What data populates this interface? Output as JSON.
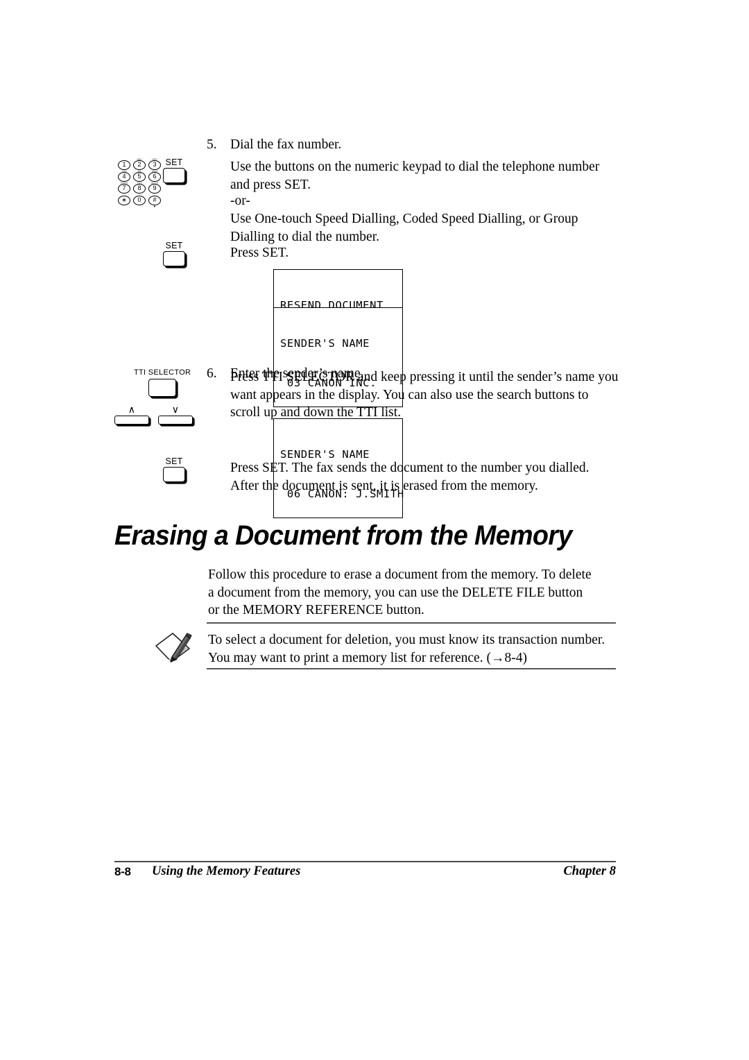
{
  "page": {
    "background": "#ffffff"
  },
  "steps": [
    {
      "number": "5.",
      "title": "Dial the fax number.",
      "paragraphs": [
        "Use the buttons on the numeric keypad to dial the telephone number and press SET.",
        "-or-",
        "Use One-touch Speed Dialling, Coded Speed Dialling, or Group Dialling to dial the number.",
        "Press SET."
      ]
    },
    {
      "number": "6.",
      "title": "Enter the sender’s name.",
      "paragraphs": [
        "Press TTI SELECTOR and keep pressing it until the sender’s name you want appears in the display. You can also use the search buttons to scroll up and down the TTI list.",
        "Press SET. The fax sends the document to the number you dialled. After the document is sent, it is erased from the memory."
      ]
    }
  ],
  "displays": [
    {
      "line1": "RESEND DOCUMENT",
      "line2": "SENDER'S NAME"
    },
    {
      "line1": "SENDER'S NAME",
      "line2": " 03 CANON INC."
    },
    {
      "line1": "SENDER'S NAME",
      "line2": " 06 CANON: J.SMITH"
    }
  ],
  "buttons": {
    "set": "SET",
    "tti_selector": "TTI SELECTOR",
    "search_up": "∧",
    "search_down": "∨"
  },
  "keypad": {
    "keys": [
      {
        "digit": "1",
        "sub": ""
      },
      {
        "digit": "2",
        "sub": "ABC"
      },
      {
        "digit": "3",
        "sub": "DEF"
      },
      {
        "digit": "4",
        "sub": "GHI"
      },
      {
        "digit": "5",
        "sub": "JKL"
      },
      {
        "digit": "6",
        "sub": "MNO"
      },
      {
        "digit": "7",
        "sub": "PQRS"
      },
      {
        "digit": "8",
        "sub": "TUV"
      },
      {
        "digit": "9",
        "sub": "WXYZ"
      },
      {
        "digit": "∗",
        "sub": ""
      },
      {
        "digit": "0",
        "sub": ""
      },
      {
        "digit": "#",
        "sub": ""
      }
    ]
  },
  "section": {
    "heading": "Erasing a Document from the Memory",
    "intro": "Follow this procedure to erase a document from the memory. To delete a document from the memory, you can use the DELETE FILE button or the MEMORY REFERENCE button."
  },
  "note": {
    "icon": "pencil-note-icon",
    "text": "To select a document for deletion, you must know its transaction number. You may want to print a memory list for reference. (→8-4)"
  },
  "footer": {
    "page_number": "8-8",
    "title": "Using the Memory Features",
    "chapter": "Chapter 8"
  }
}
